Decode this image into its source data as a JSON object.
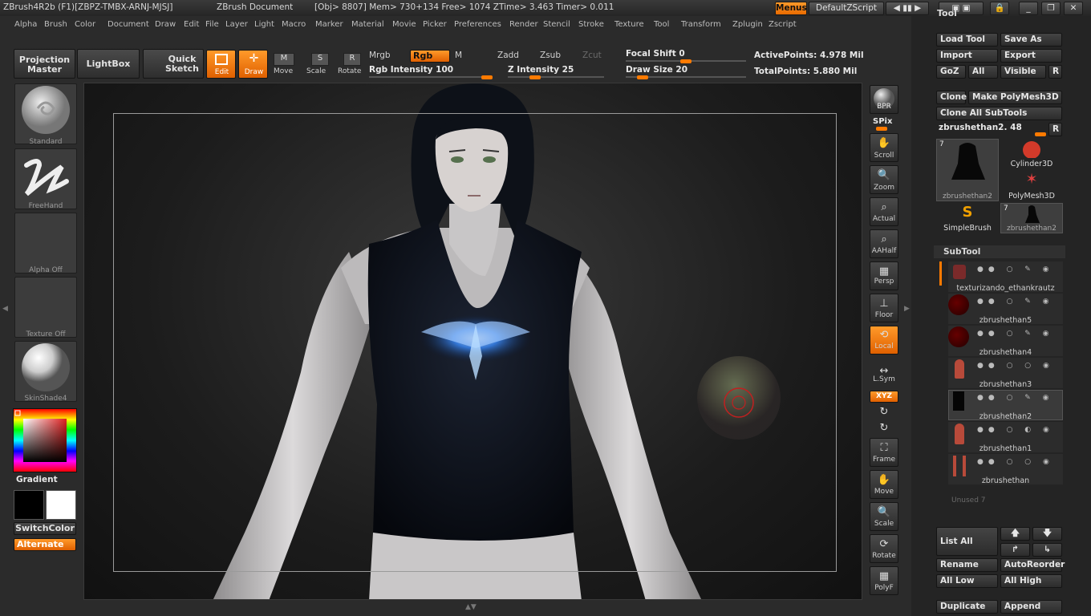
{
  "titlebar": {
    "app": "ZBrush4R2b (F1)[ZBPZ-TMBX-ARNJ-MJSJ]",
    "doc": "ZBrush Document",
    "stats": "[Obj> 8807] Mem> 730+134 Free> 1074 ZTime> 3.463 Timer> 0.011",
    "menus_btn": "Menus",
    "script_btn": "DefaultZScript",
    "tool_tab": "Tool"
  },
  "menubar": [
    "Alpha",
    "Brush",
    "Color",
    "Document",
    "Draw",
    "Edit",
    "File",
    "Layer",
    "Light",
    "Macro",
    "Marker",
    "Material",
    "Movie",
    "Picker",
    "Preferences",
    "Render",
    "Stencil",
    "Stroke",
    "Texture",
    "Tool",
    "Transform",
    "Zplugin",
    "Zscript"
  ],
  "toolbar": {
    "projection_master": "Projection Master",
    "lightbox": "LightBox",
    "quick_sketch": "Quick Sketch",
    "edit": "Edit",
    "draw": "Draw",
    "move": "Move",
    "scale": "Scale",
    "rotate": "Rotate",
    "mrgb": "Mrgb",
    "rgb": "Rgb",
    "m": "M",
    "zadd": "Zadd",
    "zsub": "Zsub",
    "zcut": "Zcut",
    "rgb_intensity": "Rgb Intensity 100",
    "z_intensity": "Z Intensity 25",
    "focal_shift": "Focal Shift 0",
    "draw_size": "Draw Size 20",
    "active_points": "ActivePoints: 4.978 Mil",
    "total_points": "TotalPoints: 5.880 Mil",
    "rgb_intensity_value": 100,
    "z_intensity_value": 25,
    "focal_shift_value": 0,
    "draw_size_value": 20
  },
  "leftpanel": {
    "brush": "Standard",
    "stroke": "FreeHand",
    "alpha": "Alpha Off",
    "texture": "Texture Off",
    "material": "SkinShade4",
    "gradient": "Gradient",
    "switchcolor": "SwitchColor",
    "alternate": "Alternate"
  },
  "rightcolumn": [
    "BPR",
    "SPix",
    "Scroll",
    "Zoom",
    "Actual",
    "AAHalf",
    "Persp",
    "Floor",
    "Local",
    "L.Sym",
    "XYZ",
    "Frame",
    "Move",
    "Scale",
    "Rotate",
    "PolyF"
  ],
  "toolpanel": {
    "load_tool": "Load Tool",
    "save_as": "Save As",
    "import": "Import",
    "export": "Export",
    "goz": "GoZ",
    "all": "All",
    "visible": "Visible",
    "r": "R",
    "clone": "Clone",
    "make_polymesh": "Make PolyMesh3D",
    "clone_all": "Clone All SubTools",
    "current_tool": "zbrushethan2. 48",
    "thumbs": [
      {
        "name": "zbrushethan2",
        "count": "7"
      },
      {
        "name": "Cylinder3D"
      },
      {
        "name": "PolyMesh3D"
      },
      {
        "name": "SimpleBrush"
      },
      {
        "name": "zbrushethan2",
        "count": "7"
      }
    ]
  },
  "subtool": {
    "header": "SubTool",
    "items": [
      "texturizando_ethankrautz",
      "zbrushethan5",
      "zbrushethan4",
      "zbrushethan3",
      "zbrushethan2",
      "zbrushethan1",
      "zbrushethan"
    ],
    "unused": "Unused 7",
    "list_all": "List All",
    "rename": "Rename",
    "autoreorder": "AutoReorder",
    "all_low": "All Low",
    "all_high": "All High",
    "duplicate": "Duplicate",
    "append": "Append"
  },
  "colors": {
    "accent": "#ff7a00",
    "panel": "#2b2b2b"
  }
}
